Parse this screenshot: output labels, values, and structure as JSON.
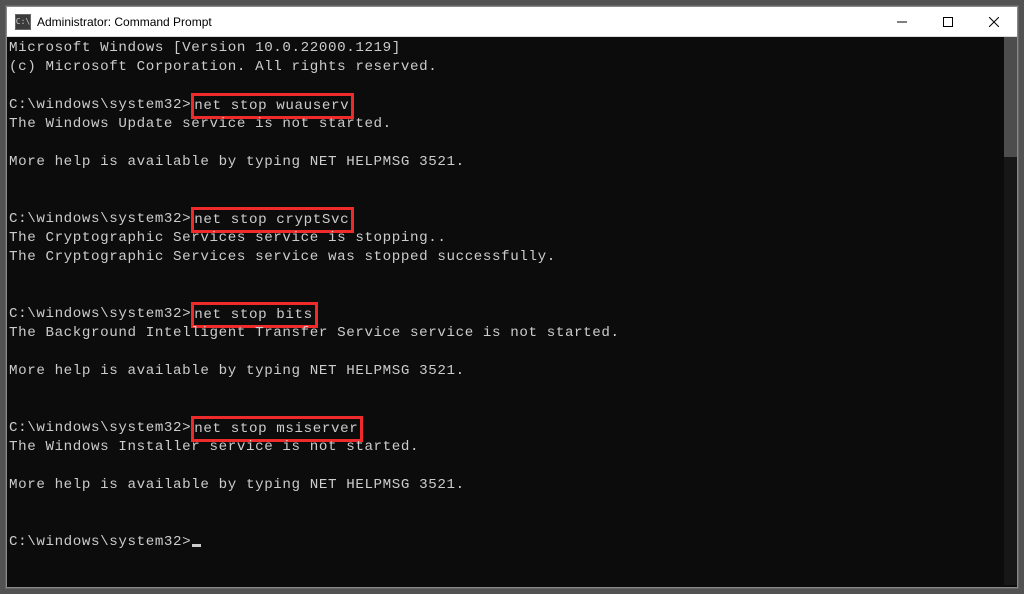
{
  "window": {
    "title": "Administrator: Command Prompt",
    "icon_text": "C:\\"
  },
  "terminal": {
    "version_line": "Microsoft Windows [Version 10.0.22000.1219]",
    "copyright_line": "(c) Microsoft Corporation. All rights reserved.",
    "prompt": "C:\\windows\\system32>",
    "blocks": [
      {
        "cmd": "net stop wuauserv",
        "output": [
          "The Windows Update service is not started.",
          "",
          "More help is available by typing NET HELPMSG 3521."
        ]
      },
      {
        "cmd": "net stop cryptSvc",
        "output": [
          "The Cryptographic Services service is stopping..",
          "The Cryptographic Services service was stopped successfully."
        ]
      },
      {
        "cmd": "net stop bits",
        "output": [
          "The Background Intelligent Transfer Service service is not started.",
          "",
          "More help is available by typing NET HELPMSG 3521."
        ]
      },
      {
        "cmd": "net stop msiserver",
        "output": [
          "The Windows Installer service is not started.",
          "",
          "More help is available by typing NET HELPMSG 3521."
        ]
      }
    ]
  }
}
